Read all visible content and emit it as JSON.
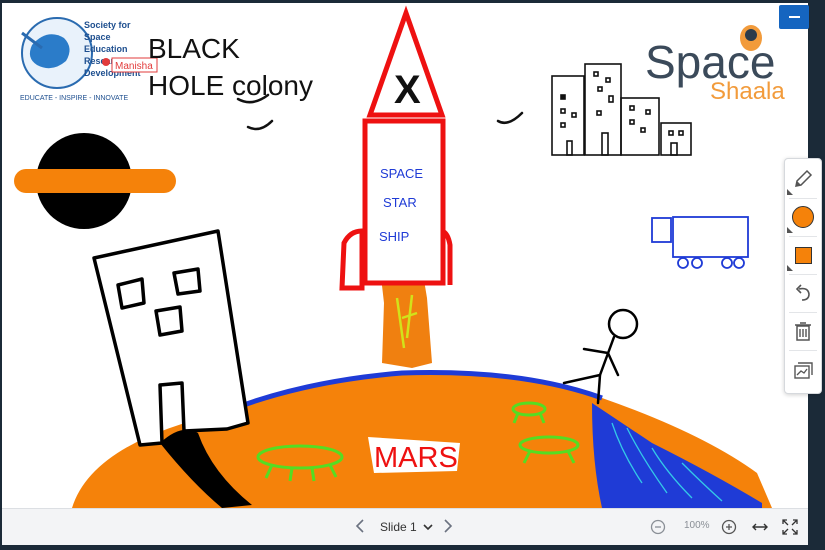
{
  "window": {
    "minimize_label": "–"
  },
  "board": {
    "logo_org_lines": [
      "Society for",
      "Space",
      "Education",
      "Research",
      "Development"
    ],
    "logo_tagline": "EDUCATE - INSPIRE - INNOVATE",
    "presenter_tag": "Manisha",
    "brand_top": "Space",
    "brand_bottom": "Shaala",
    "title_line1": "BLACK",
    "title_line2": "HOLE colony",
    "rocket_mark": "X",
    "rocket_text": [
      "SPACE",
      "STAR",
      "SHIP"
    ],
    "planet_label": "MARS"
  },
  "toolbar": {
    "tools": [
      {
        "id": "pen",
        "icon": "pencil-icon"
      },
      {
        "id": "circle",
        "icon": "circle-shape-icon",
        "color": "#f5820a"
      },
      {
        "id": "square",
        "icon": "square-shape-icon",
        "color": "#f5820a"
      },
      {
        "id": "undo",
        "icon": "undo-icon"
      },
      {
        "id": "delete",
        "icon": "trash-icon"
      },
      {
        "id": "slides",
        "icon": "slides-icon"
      }
    ]
  },
  "footer": {
    "slide_label": "Slide 1",
    "zoom_level": "100%"
  },
  "colors": {
    "orange": "#f5820a",
    "blue": "#1f3bd6",
    "red": "#ee1111",
    "green": "#55dd22",
    "accent": "#1565c0"
  }
}
